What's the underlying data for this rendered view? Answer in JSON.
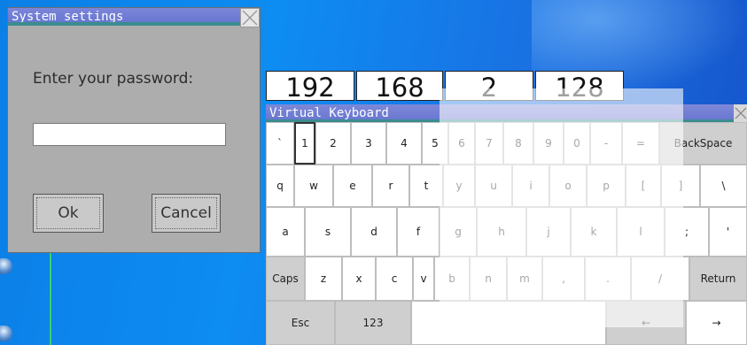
{
  "dialog": {
    "title": "System settings",
    "prompt": "Enter your password:",
    "password_value": "",
    "ok_label": "Ok",
    "cancel_label": "Cancel"
  },
  "ip": [
    "192",
    "168",
    "2",
    "128"
  ],
  "keyboard": {
    "title": "Virtual Keyboard",
    "row1": [
      "`",
      "1",
      "2",
      "3",
      "4",
      "5",
      "6",
      "7",
      "8",
      "9",
      "0",
      "-",
      "=",
      "BackSpace"
    ],
    "row2": [
      "q",
      "w",
      "e",
      "r",
      "t",
      "y",
      "u",
      "i",
      "o",
      "p",
      "[",
      "]",
      "\\"
    ],
    "row3": [
      "a",
      "s",
      "d",
      "f",
      "g",
      "h",
      "j",
      "k",
      "l",
      ";",
      "'"
    ],
    "row4": [
      "Caps",
      "z",
      "x",
      "c",
      "v",
      "b",
      "n",
      "m",
      ",",
      ".",
      "/",
      "Return"
    ],
    "row5": [
      "Esc",
      "123",
      "",
      "←",
      "→"
    ]
  },
  "colors": {
    "desktop": "#0d8cf2",
    "titlebar": "#6b78d2",
    "dialog_bg": "#adadad"
  }
}
